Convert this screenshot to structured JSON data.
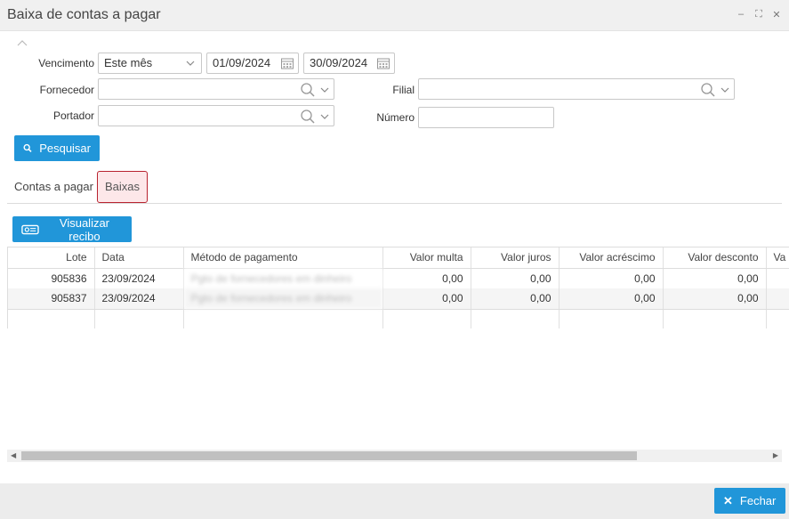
{
  "window": {
    "title": "Baixa de contas a pagar",
    "controls": [
      "minimize",
      "maximize",
      "close"
    ]
  },
  "filters": {
    "vencimento_label": "Vencimento",
    "vencimento_value": "Este mês",
    "date_start": "01/09/2024",
    "date_end": "30/09/2024",
    "fornecedor_label": "Fornecedor",
    "filial_label": "Filial",
    "portador_label": "Portador",
    "numero_label": "Número",
    "search_button": "Pesquisar"
  },
  "tabs": [
    "Contas a pagar",
    "Baixas"
  ],
  "active_tab": "Baixas",
  "toolbar": {
    "receipt_button": "Visualizar recibo"
  },
  "grid": {
    "columns": [
      "Lote",
      "Data",
      "Método de pagamento",
      "Valor multa",
      "Valor juros",
      "Valor acréscimo",
      "Valor desconto",
      "Va"
    ],
    "rows": [
      {
        "lote": "905836",
        "data": "23/09/2024",
        "metodo": "Pgto de fornecedores em dinheiro",
        "multa": "0,00",
        "juros": "0,00",
        "acrescimo": "0,00",
        "desconto": "0,00"
      },
      {
        "lote": "905837",
        "data": "23/09/2024",
        "metodo": "Pgto de fornecedores em dinheiro",
        "multa": "0,00",
        "juros": "0,00",
        "acrescimo": "0,00",
        "desconto": "0,00"
      }
    ]
  },
  "footer": {
    "close_button": "Fechar"
  },
  "colors": {
    "primary": "#2196d9",
    "active_tab_border": "#b8232f",
    "active_tab_bg": "#fde7e9"
  }
}
